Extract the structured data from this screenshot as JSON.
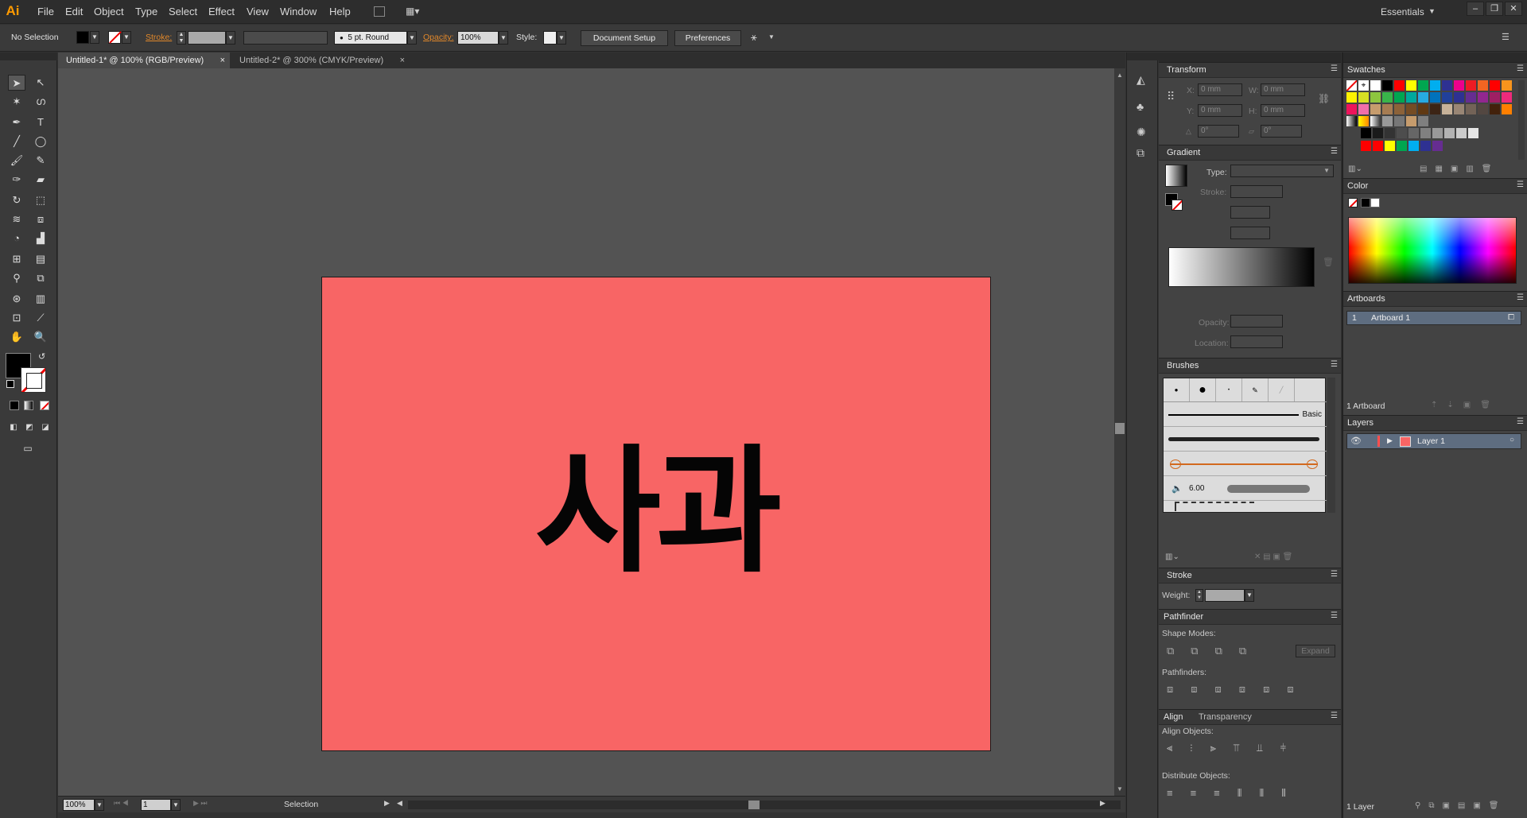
{
  "app": {
    "logo": "Ai",
    "workspace": "Essentials"
  },
  "menu": [
    "File",
    "Edit",
    "Object",
    "Type",
    "Select",
    "Effect",
    "View",
    "Window",
    "Help"
  ],
  "control": {
    "selection": "No Selection",
    "stroke_label": "Stroke:",
    "brush": "5 pt. Round",
    "opacity_label": "Opacity:",
    "opacity_value": "100%",
    "style_label": "Style:",
    "doc_setup": "Document Setup",
    "preferences": "Preferences"
  },
  "tabs": [
    {
      "label": "Untitled-1* @ 100% (RGB/Preview)"
    },
    {
      "label": "Untitled-2* @ 300% (CMYK/Preview)"
    }
  ],
  "artboard": {
    "text": "사과",
    "fill": "#f86565"
  },
  "status": {
    "zoom": "100%",
    "page": "1",
    "tool": "Selection"
  },
  "transform": {
    "title": "Transform",
    "x_label": "X:",
    "x": "0 mm",
    "w_label": "W:",
    "w": "0 mm",
    "y_label": "Y:",
    "y": "0 mm",
    "h_label": "H:",
    "h": "0 mm",
    "rot": "0°",
    "shear": "0°"
  },
  "gradient": {
    "title": "Gradient",
    "type_label": "Type:",
    "stroke_label": "Stroke:",
    "opacity_label": "Opacity:",
    "location_label": "Location:"
  },
  "brushes": {
    "title": "Brushes",
    "basic": "Basic",
    "size": "6.00"
  },
  "stroke": {
    "title": "Stroke",
    "weight_label": "Weight:"
  },
  "pathfinder": {
    "title": "Pathfinder",
    "shape_modes": "Shape Modes:",
    "expand": "Expand",
    "pathfinders": "Pathfinders:"
  },
  "align": {
    "title": "Align",
    "tab2": "Transparency",
    "align_objects": "Align Objects:",
    "distribute_objects": "Distribute Objects:"
  },
  "swatches": {
    "title": "Swatches"
  },
  "color": {
    "title": "Color"
  },
  "artboards": {
    "title": "Artboards",
    "num": "1",
    "name": "Artboard 1",
    "count": "1 Artboard"
  },
  "layers": {
    "title": "Layers",
    "name": "Layer 1",
    "count": "1 Layer",
    "color": "#ff4f4f"
  }
}
